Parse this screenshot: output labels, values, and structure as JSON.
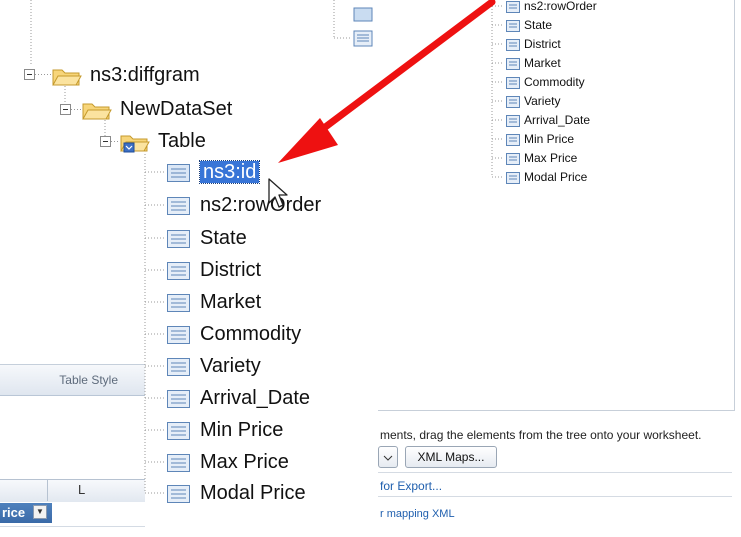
{
  "background": {
    "ribbon_group_label": "Table Style",
    "column_letter": "L",
    "header_cell_text": "rice",
    "header_dropdown_glyph": "▼"
  },
  "xml_source": {
    "hint_text": "ments, drag the elements from the tree onto your worksheet.",
    "xml_maps_button": "XML Maps...",
    "export_link": "for Export...",
    "mapping_link": "r mapping XML",
    "small_tree_items": [
      "ns2:rowOrder",
      "State",
      "District",
      "Market",
      "Commodity",
      "Variety",
      "Arrival_Date",
      "Min Price",
      "Max Price",
      "Modal Price"
    ]
  },
  "zoom_tree": {
    "diffgram": "ns3:diffgram",
    "dataset": "NewDataSet",
    "table": "Table",
    "selected": "ns3:id",
    "items": [
      "ns2:rowOrder",
      "State",
      "District",
      "Market",
      "Commodity",
      "Variety",
      "Arrival_Date",
      "Min Price",
      "Max Price",
      "Modal Price"
    ]
  },
  "colors": {
    "arrow": "#ee1111",
    "selection": "#3875d7",
    "folder": "#f3c65a",
    "element_icon": "#7aa6d6"
  },
  "icons": {
    "folder": "folder-icon",
    "element": "xml-element-icon",
    "expand": "minus-box-icon",
    "cursor": "mouse-pointer-icon",
    "arrow": "red-arrow-icon"
  }
}
